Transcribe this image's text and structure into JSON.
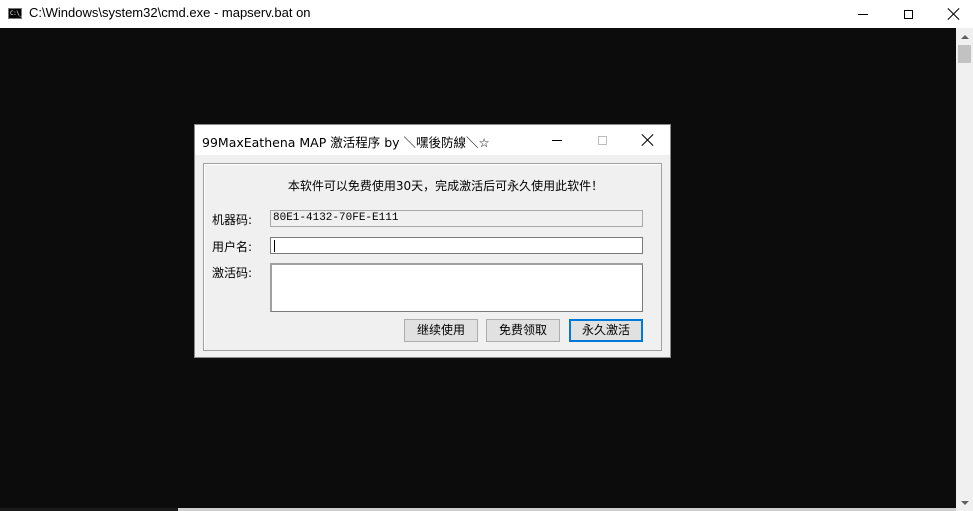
{
  "console_window": {
    "title": "C:\\Windows\\system32\\cmd.exe - mapserv.bat  on",
    "icon_text": "C:\\_"
  },
  "dialog": {
    "title": "99MaxEathena MAP 激活程序 by ＼嘿後防線＼☆",
    "notice": "本软件可以免费使用30天，完成激活后可永久使用此软件！",
    "machine_code_label": "机器码:",
    "machine_code_value": "80E1-4132-70FE-E111",
    "username_label": "用户名:",
    "username_value": "",
    "activation_code_label": "激活码:",
    "activation_code_value": "",
    "buttons": {
      "continue": "继续使用",
      "free": "免费领取",
      "permanent": "永久激活"
    }
  },
  "colors": {
    "console_bg": "#0c0c0c",
    "focus_accent": "#0078d7"
  }
}
